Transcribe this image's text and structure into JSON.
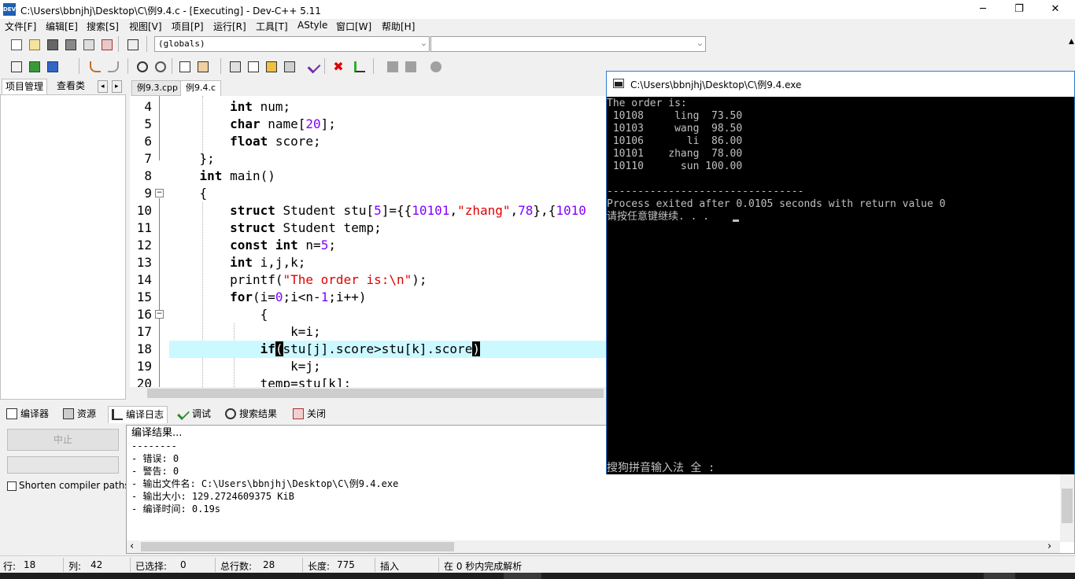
{
  "window": {
    "title": "C:\\Users\\bbnjhj\\Desktop\\C\\例9.4.c - [Executing] - Dev-C++ 5.11",
    "icon_text": "DEV",
    "minimize": "─",
    "maximize": "❐",
    "close": "✕"
  },
  "menu": [
    "文件[F]",
    "编辑[E]",
    "搜索[S]",
    "视图[V]",
    "项目[P]",
    "运行[R]",
    "工具[T]",
    "AStyle",
    "窗口[W]",
    "帮助[H]"
  ],
  "toolbar": {
    "scope_combo": "(globals)",
    "symbol_combo": "",
    "combo_arrow": "⌵"
  },
  "left_panel": {
    "tabs": [
      "项目管理",
      "查看类"
    ],
    "prev": "◂",
    "next": "▸"
  },
  "editor": {
    "tabs": [
      "例9.3.cpp",
      "例9.4.c"
    ],
    "active_tab": 1,
    "line_numbers": [
      "4",
      "5",
      "6",
      "7",
      "8",
      "9",
      "10",
      "11",
      "12",
      "13",
      "14",
      "15",
      "16",
      "17",
      "18",
      "19",
      "20"
    ],
    "fold_minus": "−",
    "lines": {
      "l4": {
        "kw": "int",
        "rest": " num;"
      },
      "l5": {
        "kw": "char",
        "rest1": " name[",
        "num": "20",
        "rest2": "];"
      },
      "l6": {
        "kw": "float",
        "rest": " score;"
      },
      "l7": {
        "rest": "};"
      },
      "l8": {
        "kw": "int",
        "rest": " main()"
      },
      "l9": {
        "rest": "{"
      },
      "l10": {
        "kw": "struct",
        "p1": " Student stu[",
        "n1": "5",
        "p2": "]={{",
        "n2": "10101",
        "p3": ",",
        "s1": "\"zhang\"",
        "p4": ",",
        "n3": "78",
        "p5": "},{",
        "n4": "1010"
      },
      "l11": {
        "kw": "struct",
        "rest": " Student temp;"
      },
      "l12": {
        "kw": "const",
        "kw2": "int",
        "p1": " n=",
        "n1": "5",
        "p2": ";"
      },
      "l13": {
        "kw": "int",
        "rest": " i,j,k;"
      },
      "l14": {
        "p1": "printf(",
        "s1": "\"The order is:\\n\"",
        "p2": ");"
      },
      "l15": {
        "kw": "for",
        "p1": "(i=",
        "n1": "0",
        "p2": ";i<n-",
        "n2": "1",
        "p3": ";i++)"
      },
      "l16": {
        "rest": "{"
      },
      "l17": {
        "rest": "k=i;"
      },
      "l18": {
        "kw": "if",
        "b1": "(",
        "mid": "stu[j].score>stu[k].score",
        "b2": ")"
      },
      "l19": {
        "rest": "k=j;"
      },
      "l20": {
        "rest": "temp=stu[k];"
      }
    }
  },
  "bottom_tabs": [
    "编译器",
    "资源",
    "编译日志",
    "调试",
    "搜索结果",
    "关闭"
  ],
  "bottom_active": 2,
  "compiler_panel": {
    "stop_button": "中止",
    "shorten_label": "Shorten compiler paths",
    "log": [
      "编译结果...",
      "--------",
      "- 错误: 0",
      "- 警告: 0",
      "- 输出文件名: C:\\Users\\bbnjhj\\Desktop\\C\\例9.4.exe",
      "- 输出大小: 129.2724609375 KiB",
      "- 编译时间: 0.19s"
    ],
    "scroll_left": "‹",
    "scroll_right": "›",
    "scroll_up": "⌃",
    "scroll_down": "⌄"
  },
  "statusbar": {
    "row_label": "行:",
    "row_value": "18",
    "col_label": "列:",
    "col_value": "42",
    "sel_label": "已选择:",
    "sel_value": "0",
    "total_label": "总行数:",
    "total_value": "28",
    "len_label": "长度:",
    "len_value": "775",
    "mode": "插入",
    "parse": "在 0 秒内完成解析"
  },
  "console": {
    "title": "C:\\Users\\bbnjhj\\Desktop\\C\\例9.4.exe",
    "lines": [
      "The order is:",
      " 10108     ling  73.50",
      " 10103     wang  98.50",
      " 10106       li  86.00",
      " 10101    zhang  78.00",
      " 10110      sun 100.00",
      "",
      "--------------------------------",
      "Process exited after 0.0105 seconds with return value 0",
      "请按任意键继续. . ."
    ],
    "ime": "搜狗拼音输入法 全 :"
  },
  "colors": {
    "accent": "#2b79d0",
    "highlight_line": "#ccf8ff",
    "string": "#e00000",
    "number": "#8000ff"
  }
}
